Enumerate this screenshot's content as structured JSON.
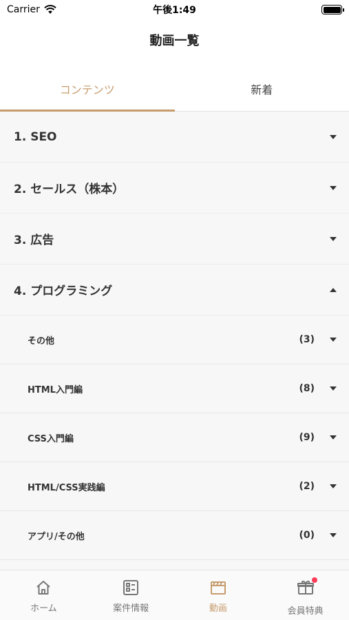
{
  "status_bar": {
    "carrier": "Carrier",
    "time": "午後1:49"
  },
  "nav": {
    "title": "動画一覧"
  },
  "tabs": [
    {
      "label": "コンテンツ",
      "active": true
    },
    {
      "label": "新着",
      "active": false
    }
  ],
  "categories": [
    {
      "label": "1. SEO",
      "expanded": false
    },
    {
      "label": "2. セールス（株本）",
      "expanded": false
    },
    {
      "label": "3. 広告",
      "expanded": false
    },
    {
      "label": "4. プログラミング",
      "expanded": true
    }
  ],
  "subcategories": [
    {
      "label": "その他",
      "count": "(3)"
    },
    {
      "label": "HTML入門編",
      "count": "(8)"
    },
    {
      "label": "CSS入門編",
      "count": "(9)"
    },
    {
      "label": "HTML/CSS実践編",
      "count": "(2)"
    },
    {
      "label": "アプリ/その他",
      "count": "(0)"
    }
  ],
  "tabbar": [
    {
      "label": "ホーム",
      "icon": "home-icon",
      "active": false
    },
    {
      "label": "案件情報",
      "icon": "list-icon",
      "active": false
    },
    {
      "label": "動画",
      "icon": "clapperboard-icon",
      "active": true
    },
    {
      "label": "会員特典",
      "icon": "gift-icon",
      "active": false,
      "badge": true
    }
  ],
  "colors": {
    "accent": "#c69c6d",
    "badge": "#ff3b57"
  }
}
